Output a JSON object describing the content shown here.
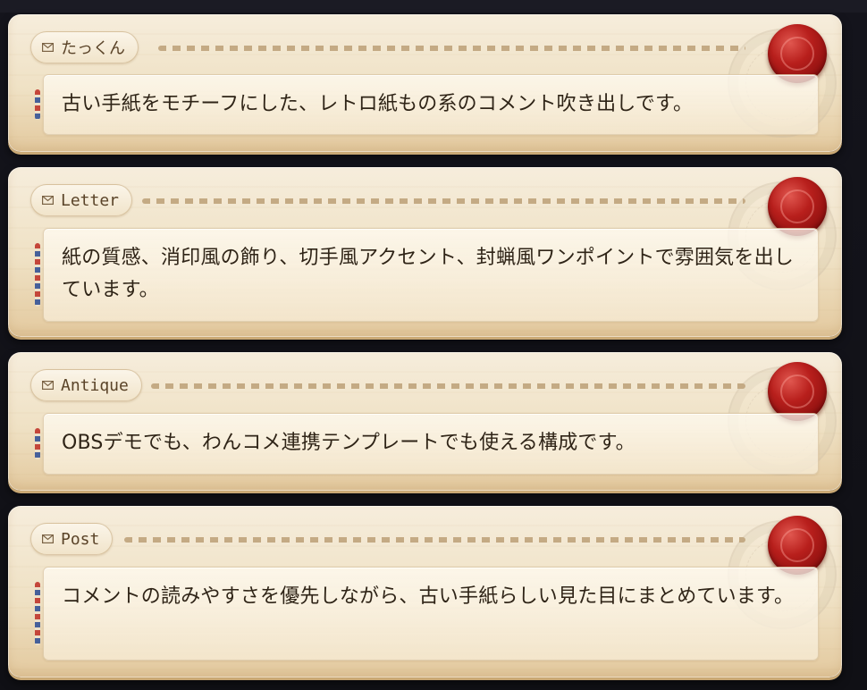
{
  "comments": [
    {
      "author": "たっくん",
      "message": "古い手紙をモチーフにした、レトロ紙もの系のコメント吹き出しです。"
    },
    {
      "author": "Letter",
      "message": "紙の質感、消印風の飾り、切手風アクセント、封蝋風ワンポイントで雰囲気を出しています。"
    },
    {
      "author": "Antique",
      "message": "OBSデモでも、わんコメ連携テンプレートでも使える構成です。"
    },
    {
      "author": "Post",
      "message": "コメントの読みやすさを優先しながら、古い手紙らしい見た目にまとめています。"
    }
  ],
  "colors": {
    "paper": "#efe1c4",
    "ink": "#2f2417",
    "wax_seal": "#b81f1c",
    "stamp_red": "#c4463a",
    "stamp_blue": "#46609a",
    "background": "#16151a"
  },
  "icons": {
    "name_tag": "envelope-icon",
    "seal": "wax-seal-icon",
    "decoration": "postmark-icon"
  }
}
